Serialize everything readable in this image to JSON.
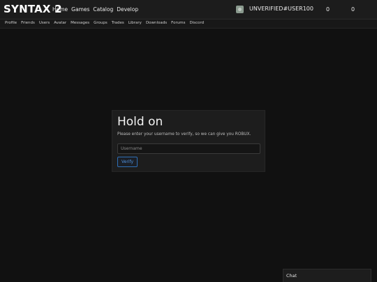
{
  "header": {
    "brand": "SYNTAX 2",
    "nav": [
      "Home",
      "Games",
      "Catalog",
      "Develop"
    ],
    "username": "UNVERIFIED#USER100",
    "count_1": "0",
    "count_2": "0"
  },
  "subnav": [
    "Profile",
    "Friends",
    "Users",
    "Avatar",
    "Messages",
    "Groups",
    "Trades",
    "Library",
    "Downloads",
    "Forums",
    "Discord"
  ],
  "verify": {
    "title": "Hold on",
    "description": "Please enter your username to verify, so we can give you ROBUX.",
    "input_placeholder": "Username",
    "input_value": "",
    "button_label": "Verify"
  },
  "chat": {
    "label": "Chat"
  },
  "colors": {
    "background": "#111111",
    "topbar": "#1c1c1c",
    "card": "#1d1d1d",
    "accent": "#2f6fb6"
  }
}
